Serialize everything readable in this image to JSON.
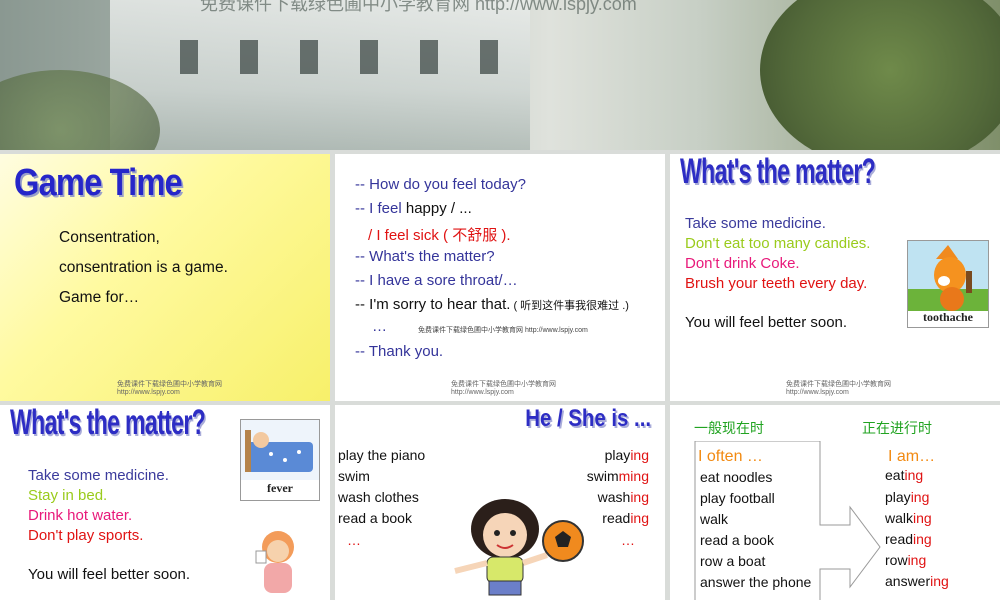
{
  "banner": {
    "caption": "免费课件下载绿色圃中小学教育网 http://www.lspjy.com"
  },
  "slide1": {
    "title": "Game Time",
    "lines": [
      "Consentration,",
      "consentration is a game.",
      "Game for…"
    ],
    "footer": [
      "免费课件下载绿色圃中小学教育网",
      "http://www.lspjy.com"
    ]
  },
  "slide2": {
    "l1": "-- How do you feel today?",
    "l2a": "-- I feel ",
    "l2b": "happy / ...",
    "l3a": "/ I feel ",
    "l3b": "sick",
    "l3c": " ( 不舒服 ).",
    "l4": "-- What's the matter?",
    "l5": "-- I have a sore throat/…",
    "l6a": "-- I'm sorry to hear that.",
    "l6b": " ( 听到这件事我很难过 .)",
    "l7": "…",
    "l7note": "免费课件下载绿色圃中小学教育网 http://www.lspjy.com",
    "l8": "-- Thank you.",
    "footer": [
      "免费课件下载绿色圃中小学教育网",
      "http://www.lspjy.com"
    ]
  },
  "slide3": {
    "title": "What's the matter?",
    "l1": "Take some medicine.",
    "l2": "Don't eat too many candies.",
    "l3": "Don't drink Coke.",
    "l4": "Brush your teeth every day.",
    "l5": "You will feel better soon.",
    "picture_label": "toothache",
    "footer": [
      "免费课件下载绿色圃中小学教育网",
      "http://www.lspjy.com"
    ]
  },
  "slide4": {
    "title": "What's the matter?",
    "l1": "Take some medicine.",
    "l2": "Stay in bed.",
    "l3": "Drink hot water.",
    "l4": "Don't play sports.",
    "l5": "You will feel better soon.",
    "picture_label": "fever"
  },
  "slide5": {
    "title": "He / She is ...",
    "left": [
      "play the piano",
      "swim",
      "wash clothes",
      "read a book",
      "…"
    ],
    "right": [
      {
        "stem": "play",
        "suffix": "ing"
      },
      {
        "stem": "swim",
        "suffix": "ming"
      },
      {
        "stem": "wash",
        "suffix": "ing"
      },
      {
        "stem": "read",
        "suffix": "ing"
      }
    ],
    "ellipsis": "…"
  },
  "slide6": {
    "head_left": "一般现在时",
    "head_right": "正在进行时",
    "left_title": "I often …",
    "right_title": "I am…",
    "left": [
      "eat noodles",
      "play football",
      "walk",
      "read a book",
      "row a boat",
      "answer the phone"
    ],
    "right": [
      {
        "stem": "eat",
        "suffix": "ing"
      },
      {
        "stem": "play",
        "suffix": "ing"
      },
      {
        "stem": "walk",
        "suffix": "ing"
      },
      {
        "stem": "read",
        "suffix": "ing"
      },
      {
        "stem": "row",
        "suffix": "ing"
      },
      {
        "stem": "answer",
        "suffix": "ing"
      }
    ]
  },
  "colors": {
    "title_blue": "#2d2dc4",
    "nav_blue": "#34349a",
    "green": "#9acb1c",
    "pink": "#e8197a",
    "red": "#e01313",
    "orange": "#f28a12"
  }
}
